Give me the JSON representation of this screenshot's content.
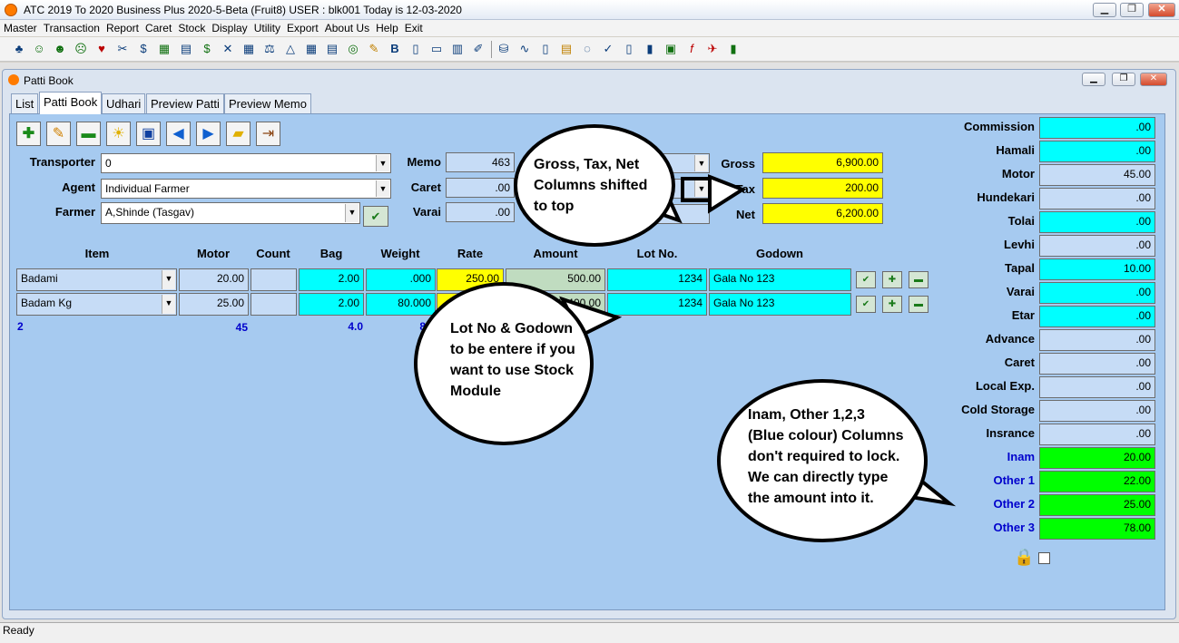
{
  "app": {
    "title": "ATC 2019 To 2020 Business Plus 2020-5-Beta (Fruit8)  USER : blk001 Today is 12-03-2020"
  },
  "menu": [
    "Master",
    "Transaction",
    "Report",
    "Caret",
    "Stock",
    "Display",
    "Utility",
    "Export",
    "About Us",
    "Help",
    "Exit"
  ],
  "toolbar_icons": [
    "palm-icon",
    "smile-icon",
    "neutral-face-icon",
    "sad-face-icon",
    "heart-shield-icon",
    "scissors-icon",
    "money-bag-icon",
    "xy-icon",
    "calc-icon",
    "ledger-icon",
    "books-icon",
    "scale-icon",
    "grid-icon",
    "table-icon",
    "globe-icon",
    "edit-icon",
    "bold-icon",
    "book-icon",
    "page-icon",
    "columns-icon",
    "ruler-icon",
    "database-icon",
    "chart-icon",
    "doc-icon",
    "list-icon",
    "chat-icon",
    "check-icon",
    "report-icon",
    "bar-chart-icon",
    "save-calc-icon",
    "fx-icon",
    "runner-icon",
    "exit-icon"
  ],
  "window": {
    "title": "Patti Book"
  },
  "tabs": [
    "List",
    "Patti Book",
    "Udhari",
    "Preview Patti",
    "Preview Memo"
  ],
  "form": {
    "transporter_label": "Transporter",
    "transporter_value": "0",
    "agent_label": "Agent",
    "agent_value": "Individual Farmer",
    "farmer_label": "Farmer",
    "farmer_value": "A,Shinde (Tasgav)",
    "memo_label": "Memo",
    "memo_value": "463",
    "caret_label": "Caret",
    "caret_value": ".00",
    "varai_label": "Varai",
    "varai_value": ".00",
    "gross_label": "Gross",
    "gross_value": "6,900.00",
    "tax_label": "Tax",
    "tax_value": "200.00",
    "net_label": "Net",
    "net_value": "6,200.00"
  },
  "grid": {
    "headers": [
      "Item",
      "Motor",
      "Count",
      "Bag",
      "Weight",
      "Rate",
      "Amount",
      "Lot No.",
      "Godown"
    ],
    "rows": [
      {
        "item": "Badami",
        "motor": "20.00",
        "count": "",
        "bag": "2.00",
        "weight": ".000",
        "rate": "250.00",
        "amount": "500.00",
        "lot": "1234",
        "godown": "Gala No 123"
      },
      {
        "item": "Badam Kg",
        "motor": "25.00",
        "count": "",
        "bag": "2.00",
        "weight": "80.000",
        "rate": "",
        "amount": "5,400.00",
        "lot": "1234",
        "godown": "Gala No 123"
      }
    ],
    "totals": {
      "items": "2",
      "motor": "45",
      "bag": "4.0",
      "weight": "8"
    }
  },
  "charges": [
    {
      "label": "Commission",
      "value": ".00",
      "color": "cyan"
    },
    {
      "label": "Hamali",
      "value": ".00",
      "color": "cyan"
    },
    {
      "label": "Motor",
      "value": "45.00",
      "color": "pale"
    },
    {
      "label": "Hundekari",
      "value": ".00",
      "color": "pale"
    },
    {
      "label": "Tolai",
      "value": ".00",
      "color": "cyan"
    },
    {
      "label": "Levhi",
      "value": ".00",
      "color": "pale"
    },
    {
      "label": "Tapal",
      "value": "10.00",
      "color": "cyan"
    },
    {
      "label": "Varai",
      "value": ".00",
      "color": "cyan"
    },
    {
      "label": "Etar",
      "value": ".00",
      "color": "cyan"
    },
    {
      "label": "Advance",
      "value": ".00",
      "color": "pale"
    },
    {
      "label": "Caret",
      "value": ".00",
      "color": "pale"
    },
    {
      "label": "Local Exp.",
      "value": ".00",
      "color": "pale"
    },
    {
      "label": "Cold Storage",
      "value": ".00",
      "color": "pale"
    },
    {
      "label": "Insrance",
      "value": ".00",
      "color": "pale"
    },
    {
      "label": "Inam",
      "value": "20.00",
      "color": "green"
    },
    {
      "label": "Other 1",
      "value": "22.00",
      "color": "green"
    },
    {
      "label": "Other 2",
      "value": "25.00",
      "color": "green"
    },
    {
      "label": "Other 3",
      "value": "78.00",
      "color": "green"
    }
  ],
  "callouts": {
    "gross": "Gross, Tax, Net Columns shifted to top",
    "lot": "Lot No & Godown to be entere if you want to use Stock Module",
    "inam": "Inam, Other 1,2,3 (Blue colour) Columns don't required to lock. We can directly type the amount into it."
  },
  "status": {
    "text": "Ready"
  }
}
